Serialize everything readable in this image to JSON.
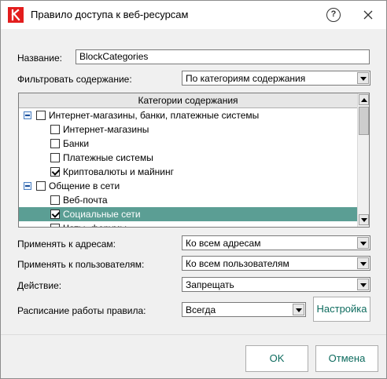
{
  "window": {
    "title": "Правило доступа к веб-ресурсам",
    "help_glyph": "?"
  },
  "form": {
    "name_label": "Название:",
    "name_value": "BlockCategories",
    "filter_label": "Фильтровать содержание:",
    "filter_value": "По категориям содержания",
    "tree": {
      "header": "Категории содержания",
      "rows": [
        {
          "label": "Интернет-магазины, банки, платежные системы",
          "level": 0,
          "checked": false,
          "expanded": true
        },
        {
          "label": "Интернет-магазины",
          "level": 1,
          "checked": false
        },
        {
          "label": "Банки",
          "level": 1,
          "checked": false
        },
        {
          "label": "Платежные системы",
          "level": 1,
          "checked": false
        },
        {
          "label": "Криптовалюты и майнинг",
          "level": 1,
          "checked": true
        },
        {
          "label": "Общение в сети",
          "level": 0,
          "checked": false,
          "expanded": true
        },
        {
          "label": "Веб-почта",
          "level": 1,
          "checked": false
        },
        {
          "label": "Социальные сети",
          "level": 1,
          "checked": true,
          "selected": true
        },
        {
          "label": "Чаты, форумы",
          "level": 1,
          "checked": false
        }
      ]
    },
    "apply_addresses_label": "Применять к адресам:",
    "apply_addresses_value": "Ко всем адресам",
    "apply_users_label": "Применять к пользователям:",
    "apply_users_value": "Ко всем пользователям",
    "action_label": "Действие:",
    "action_value": "Запрещать",
    "schedule_label": "Расписание работы правила:",
    "schedule_value": "Всегда",
    "settings_button": "Настройка"
  },
  "footer": {
    "ok_button": "OK",
    "cancel_button": "Отмена"
  },
  "colors": {
    "accent": "#0d6b5e",
    "selection": "#5b9e94",
    "logo": "#e31d1d"
  }
}
